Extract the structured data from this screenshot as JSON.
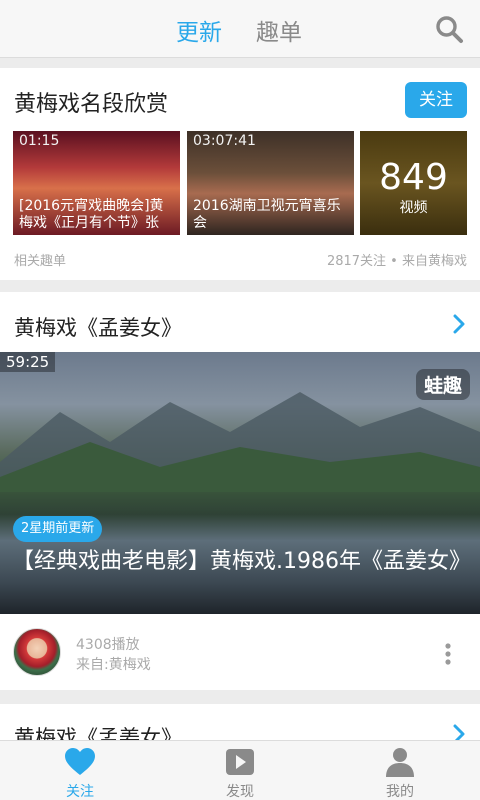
{
  "top_tabs": {
    "active": "更新",
    "inactive": "趣单"
  },
  "playlist_card": {
    "title": "黄梅戏名段欣赏",
    "follow_label": "关注",
    "thumbs": [
      {
        "duration": "01:15",
        "caption": "[2016元宵戏曲晚会]黄梅戏《正月有个节》张"
      },
      {
        "duration": "03:07:41",
        "caption": "2016湖南卫视元宵喜乐会"
      }
    ],
    "more_thumb": {
      "count": "849",
      "label": "视频"
    },
    "meta_left": "相关趣单",
    "meta_right": "2817关注 • 来自黄梅戏"
  },
  "video_card": {
    "title": "黄梅戏《孟姜女》",
    "duration": "59:25",
    "watermark": "蛙趣",
    "update_badge": "2星期前更新",
    "video_title": "【经典戏曲老电影】黄梅戏.1986年《孟姜女》",
    "plays": "4308播放",
    "source": "来自:黄梅戏"
  },
  "next_card": {
    "title": "黄梅戏《孟姜女》"
  },
  "bottom_nav": [
    {
      "label": "关注",
      "icon": "heart-icon",
      "active": true
    },
    {
      "label": "发现",
      "icon": "play-icon",
      "active": false
    },
    {
      "label": "我的",
      "icon": "person-icon",
      "active": false
    }
  ],
  "colors": {
    "accent": "#2aa8ea",
    "inactive": "#8a8a8a"
  }
}
